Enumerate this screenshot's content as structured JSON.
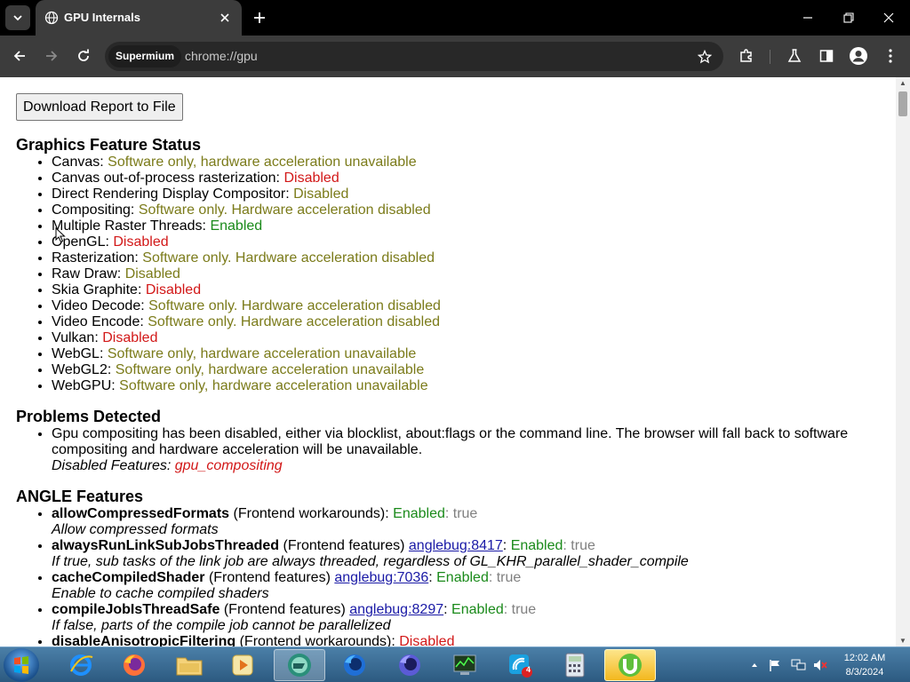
{
  "browser": {
    "tab_title": "GPU Internals",
    "profile_chip": "Supermium",
    "url": "chrome://gpu"
  },
  "page": {
    "download_button": "Download Report to File",
    "sections": {
      "graphics": {
        "title": "Graphics Feature Status",
        "items": [
          {
            "label": "Canvas: ",
            "value": "Software only, hardware acceleration unavailable",
            "status": "olive"
          },
          {
            "label": "Canvas out-of-process rasterization: ",
            "value": "Disabled",
            "status": "red"
          },
          {
            "label": "Direct Rendering Display Compositor: ",
            "value": "Disabled",
            "status": "olive"
          },
          {
            "label": "Compositing: ",
            "value": "Software only. Hardware acceleration disabled",
            "status": "olive"
          },
          {
            "label": "Multiple Raster Threads: ",
            "value": "Enabled",
            "status": "green"
          },
          {
            "label": "OpenGL: ",
            "value": "Disabled",
            "status": "red"
          },
          {
            "label": "Rasterization: ",
            "value": "Software only. Hardware acceleration disabled",
            "status": "olive"
          },
          {
            "label": "Raw Draw: ",
            "value": "Disabled",
            "status": "olive"
          },
          {
            "label": "Skia Graphite: ",
            "value": "Disabled",
            "status": "red"
          },
          {
            "label": "Video Decode: ",
            "value": "Software only. Hardware acceleration disabled",
            "status": "olive"
          },
          {
            "label": "Video Encode: ",
            "value": "Software only. Hardware acceleration disabled",
            "status": "olive"
          },
          {
            "label": "Vulkan: ",
            "value": "Disabled",
            "status": "red"
          },
          {
            "label": "WebGL: ",
            "value": "Software only, hardware acceleration unavailable",
            "status": "olive"
          },
          {
            "label": "WebGL2: ",
            "value": "Software only, hardware acceleration unavailable",
            "status": "olive"
          },
          {
            "label": "WebGPU: ",
            "value": "Software only, hardware acceleration unavailable",
            "status": "olive"
          }
        ]
      },
      "problems": {
        "title": "Problems Detected",
        "text": "Gpu compositing has been disabled, either via blocklist, about:flags or the command line. The browser will fall back to software compositing and hardware acceleration will be unavailable.",
        "disabled_label": "Disabled Features: ",
        "disabled_value": "gpu_compositing"
      },
      "angle": {
        "title": "ANGLE Features",
        "items": [
          {
            "name": "allowCompressedFormats",
            "category": " (Frontend workarounds): ",
            "link": "",
            "sep": "",
            "state": "Enabled",
            "state_color": "green",
            "value": ": true",
            "desc": "Allow compressed formats"
          },
          {
            "name": "alwaysRunLinkSubJobsThreaded",
            "category": " (Frontend features) ",
            "link": "anglebug:8417",
            "sep": ": ",
            "state": "Enabled",
            "state_color": "green",
            "value": ": true",
            "desc": "If true, sub tasks of the link job are always threaded, regardless of GL_KHR_parallel_shader_compile"
          },
          {
            "name": "cacheCompiledShader",
            "category": " (Frontend features) ",
            "link": "anglebug:7036",
            "sep": ": ",
            "state": "Enabled",
            "state_color": "green",
            "value": ": true",
            "desc": "Enable to cache compiled shaders"
          },
          {
            "name": "compileJobIsThreadSafe",
            "category": " (Frontend features) ",
            "link": "anglebug:8297",
            "sep": ": ",
            "state": "Enabled",
            "state_color": "green",
            "value": ": true",
            "desc": "If false, parts of the compile job cannot be parallelized"
          },
          {
            "name": "disableAnisotropicFiltering",
            "category": " (Frontend workarounds): ",
            "link": "",
            "sep": "",
            "state": "Disabled",
            "state_color": "red",
            "value": "",
            "desc": ""
          }
        ]
      }
    }
  },
  "taskbar": {
    "clock_time": "12:02 AM",
    "clock_date": "8/3/2024",
    "notification_badge": "4"
  },
  "colors": {
    "olive": "#7b7b1a",
    "red": "#d21818",
    "green": "#1a8a1a",
    "link": "#1a1aa6"
  }
}
